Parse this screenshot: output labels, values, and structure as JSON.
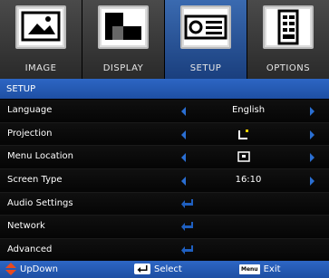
{
  "tabs": [
    {
      "label": "IMAGE",
      "icon": "image-icon",
      "active": false
    },
    {
      "label": "DISPLAY",
      "icon": "display-icon",
      "active": false
    },
    {
      "label": "SETUP",
      "icon": "projector-icon",
      "active": true
    },
    {
      "label": "OPTIONS",
      "icon": "options-icon",
      "active": false
    }
  ],
  "header": {
    "title": "SETUP"
  },
  "rows": [
    {
      "label": "Language",
      "value": "English"
    },
    {
      "label": "Projection",
      "value": ""
    },
    {
      "label": "Menu Location",
      "value": ""
    },
    {
      "label": "Screen Type",
      "value": "16:10"
    },
    {
      "label": "Audio Settings",
      "value": ""
    },
    {
      "label": "Network",
      "value": ""
    },
    {
      "label": "Advanced",
      "value": ""
    }
  ],
  "footer": {
    "updown": "UpDown",
    "select": "Select",
    "menu_key": "Menu",
    "exit": "Exit"
  },
  "colors": {
    "accent": "#2d66c4",
    "arrow": "#2a6fd3",
    "enter": "#1f5fbf",
    "updown": "#e84a1f"
  }
}
